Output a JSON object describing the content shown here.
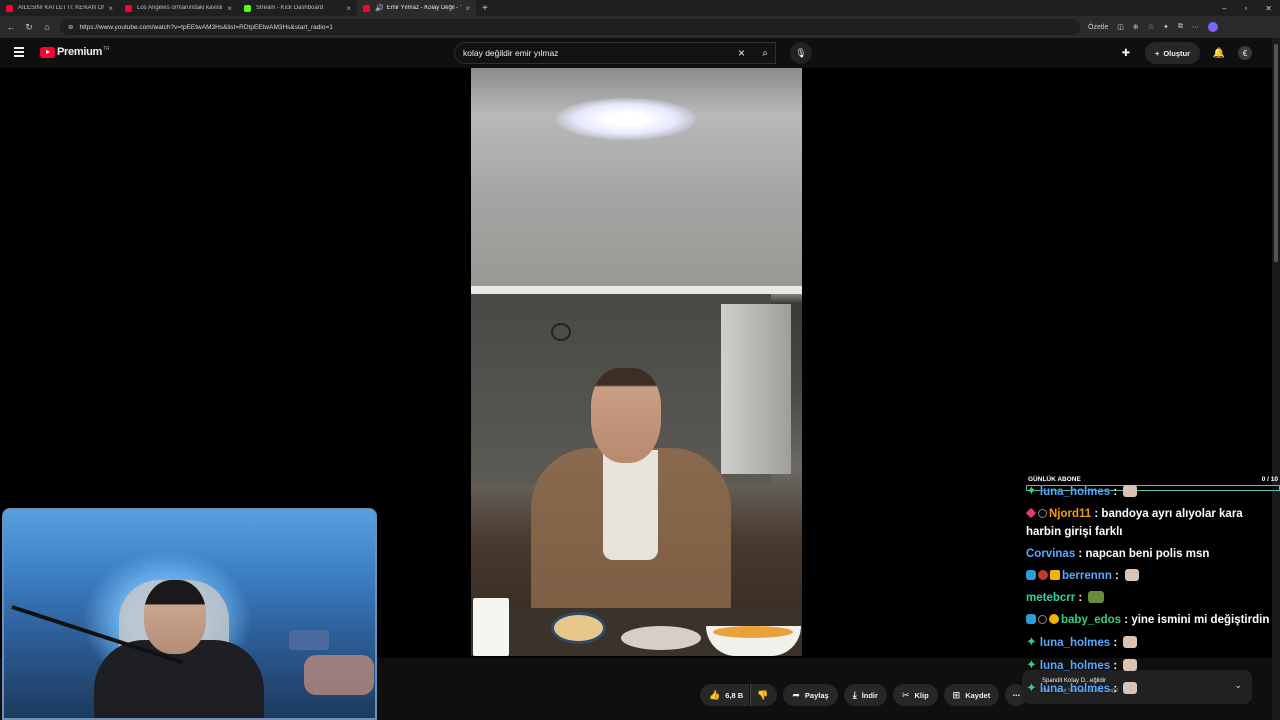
{
  "browser": {
    "tabs": [
      {
        "title": "AİLESİNİ KATLETTİ: KENAN ÖNEM...",
        "icon": "youtube",
        "active": false,
        "audio": false
      },
      {
        "title": "Los Angeles ormanındaki kavisli...",
        "icon": "youtube",
        "active": false,
        "audio": false
      },
      {
        "title": "Stream - Kick Dashboard",
        "icon": "kick",
        "active": false,
        "audio": false
      },
      {
        "title": "Emir Yılmaz - Kolay Değil - Yo...",
        "icon": "youtube",
        "active": true,
        "audio": true
      }
    ],
    "new_tab": "+",
    "url": "https://www.youtube.com/watch?v=tpEEtwAM3Hs&list=RDtpEEtwAM3Hs&start_radio=1",
    "summarize_label": "Özetle",
    "window_controls": [
      "–",
      "▫",
      "✕"
    ]
  },
  "youtube": {
    "logo_text": "Premium",
    "country_code": "TR",
    "search_query": "kolay değildir emir yılmaz",
    "create_label": "Oluştur"
  },
  "player": {
    "like_count": "6,8 B",
    "share_label": "Paylaş",
    "download_label": "İndir",
    "clip_label": "Klip",
    "save_label": "Kaydet",
    "mix_title": "Spandit Kolay D...eğildir",
    "mix_subtitle": "Mix - Emir Yılmaz - Kolay Değil"
  },
  "sub_goal": {
    "label": "GÜNLÜK ABONE",
    "count": "0 / 10",
    "progress": 0
  },
  "chat": [
    {
      "user": "luna_holmes",
      "color": "#5aa8ff",
      "badges": [
        "green"
      ],
      "text": "",
      "emote": "face"
    },
    {
      "user": "Njord11",
      "color": "#f39c12",
      "badges": [
        "gem",
        "circle"
      ],
      "text": "bandoya ayrı alıyolar kara harbin girişi farklı",
      "emote": ""
    },
    {
      "user": "Corvinas",
      "color": "#5aa8ff",
      "badges": [],
      "text": "napcan beni polis msn",
      "emote": ""
    },
    {
      "user": "berrennn",
      "color": "#5aa8ff",
      "badges": [
        "blue",
        "red",
        "crown"
      ],
      "text": "",
      "emote": "face"
    },
    {
      "user": "metebcrr",
      "color": "#35d0a8",
      "badges": [],
      "text": "",
      "emote": "green"
    },
    {
      "user": "baby_edos",
      "color": "#35d07f",
      "badges": [
        "blue",
        "circle",
        "gold"
      ],
      "text": "yine ismini mi değiştirdin",
      "emote": ""
    },
    {
      "user": "luna_holmes",
      "color": "#5aa8ff",
      "badges": [
        "green"
      ],
      "text": "",
      "emote": "face"
    },
    {
      "user": "luna_holmes",
      "color": "#5aa8ff",
      "badges": [
        "green"
      ],
      "text": "",
      "emote": "face"
    },
    {
      "user": "luna_holmes",
      "color": "#5aa8ff",
      "badges": [
        "green"
      ],
      "text": "",
      "emote": "face"
    }
  ]
}
